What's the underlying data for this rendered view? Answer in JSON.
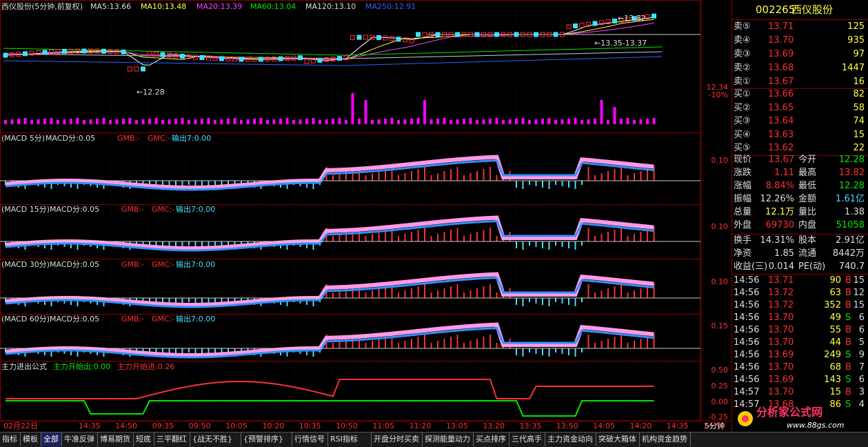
{
  "colors": {
    "red": "#ff3030",
    "cyan": "#40e0ff",
    "pink": "#ff99e6",
    "blue": "#3090ff",
    "magenta": "#ff00ff",
    "green": "#00e600",
    "yellow": "#ffff40",
    "grid": "#8b0000"
  },
  "main": {
    "title": "西仪股份(5分钟,前复权)",
    "ma5": "MA5:13.66",
    "ma10": "MA10:13.48",
    "ma20": "MA20:13.39",
    "ma60": "MA60:13.04",
    "ma120": "MA120:13.10",
    "ma250": "MA250:12.91",
    "low_annot": "←12.28",
    "high_annot": "←13.82",
    "range_annot": "←13.35-13.37",
    "scale_price": "12.34",
    "scale_pct": "-10%"
  },
  "panels": [
    {
      "name": "MACD 5分",
      "label": "(MACD 5分)",
      "param": "MACD分:0.05",
      "scale": "0.10"
    },
    {
      "name": "MACD 15分",
      "label": "(MACD 15分)",
      "param": "MACD分:0.05",
      "scale": "0.10"
    },
    {
      "name": "MACD 30分",
      "label": "(MACD 30分)",
      "param": "MACD分:0.05",
      "scale": "0.10"
    },
    {
      "name": "MACD 60分",
      "label": "(MACD 60分)",
      "param": "MACD分:0.05",
      "scale": "0.15"
    }
  ],
  "panel_tail": {
    "gmb": "GMB:-",
    "gmc": "GMC:-",
    "out": "输出7:0.00"
  },
  "zhuli": {
    "title": "主力进出公式",
    "start_out": "主力开始出:0.00",
    "start_in": "主力开始进:0.26",
    "scale": [
      "0.50",
      "0.25",
      "0.00",
      "-0.25"
    ]
  },
  "time_axis": {
    "date": "02月22日",
    "ticks": [
      "14:35",
      "14:50",
      "09:35",
      "09:50",
      "10:05",
      "10:20",
      "10:35",
      "10:50",
      "11:05",
      "11:20",
      "13:05",
      "13:20",
      "13:35",
      "13:50",
      "14:05",
      "14:20",
      "14:35",
      "14:50"
    ],
    "period": "5分钟"
  },
  "quote": {
    "code": "002265",
    "name": "西仪股份",
    "sells": [
      {
        "label": "卖⑤",
        "price": "13.71",
        "vol": "125"
      },
      {
        "label": "卖④",
        "price": "13.70",
        "vol": "935"
      },
      {
        "label": "卖③",
        "price": "13.69",
        "vol": "97"
      },
      {
        "label": "卖②",
        "price": "13.68",
        "vol": "1447"
      },
      {
        "label": "卖①",
        "price": "13.67",
        "vol": "16"
      }
    ],
    "buys": [
      {
        "label": "买①",
        "price": "13.66",
        "vol": "82"
      },
      {
        "label": "买②",
        "price": "13.65",
        "vol": "58"
      },
      {
        "label": "买③",
        "price": "13.64",
        "vol": "74"
      },
      {
        "label": "买④",
        "price": "13.63",
        "vol": "15"
      },
      {
        "label": "买⑤",
        "price": "13.62",
        "vol": "22"
      }
    ],
    "stats": [
      {
        "l1": "现价",
        "v1": "13.67",
        "l2": "今开",
        "v2": "12.28",
        "c1": "red",
        "c2": "green"
      },
      {
        "l1": "涨跌",
        "v1": "1.11",
        "l2": "最高",
        "v2": "13.82",
        "c1": "red",
        "c2": "red"
      },
      {
        "l1": "涨幅",
        "v1": "8.84%",
        "l2": "最低",
        "v2": "12.28",
        "c1": "red",
        "c2": "green"
      },
      {
        "l1": "振幅",
        "v1": "12.26%",
        "l2": "金额",
        "v2": "1.61亿",
        "c1": "white",
        "c2": "cyan"
      },
      {
        "l1": "总量",
        "v1": "12.1万",
        "l2": "量比",
        "v2": "1.38",
        "c1": "yellow",
        "c2": "white"
      },
      {
        "l1": "外盘",
        "v1": "69730",
        "l2": "内盘",
        "v2": "51058",
        "c1": "red",
        "c2": "green"
      }
    ],
    "stats2": [
      {
        "l1": "换手",
        "v1": "14.31%",
        "l2": "股本",
        "v2": "2.91亿"
      },
      {
        "l1": "净资",
        "v1": "1.85",
        "l2": "流通",
        "v2": "8442万"
      },
      {
        "l1": "收益(三)",
        "v1": "0.014",
        "l2": "PE(动)",
        "v2": "740.7"
      }
    ],
    "ticks": [
      {
        "t": "14:56",
        "p": "13.71",
        "v": "90",
        "s": "B",
        "n": "15"
      },
      {
        "t": "14:56",
        "p": "13.72",
        "v": "63",
        "s": "B",
        "n": "12"
      },
      {
        "t": "14:56",
        "p": "13.72",
        "v": "352",
        "s": "B",
        "n": "15"
      },
      {
        "t": "14:56",
        "p": "13.70",
        "v": "49",
        "s": "S",
        "n": "6"
      },
      {
        "t": "14:56",
        "p": "13.70",
        "v": "55",
        "s": "B",
        "n": "6"
      },
      {
        "t": "14:56",
        "p": "13.70",
        "v": "44",
        "s": "B",
        "n": "5"
      },
      {
        "t": "14:56",
        "p": "13.69",
        "v": "249",
        "s": "S",
        "n": "9"
      },
      {
        "t": "14:56",
        "p": "13.70",
        "v": "68",
        "s": "B",
        "n": "7"
      },
      {
        "t": "14:56",
        "p": "13.69",
        "v": "143",
        "s": "S",
        "n": "6"
      },
      {
        "t": "14:57",
        "p": "13.70",
        "v": "15",
        "s": "B",
        "n": "3"
      },
      {
        "t": "14:57",
        "p": "13.68",
        "v": "86",
        "s": "S",
        "n": "4"
      }
    ]
  },
  "watermark": {
    "text": "分析家公式网",
    "url": "www.88gs.com"
  },
  "toolbar": [
    "指标",
    "模板",
    "全部",
    "牛准反弹",
    "博易期货",
    "短底",
    "三平翻红",
    "{战无不胜}",
    "{预警排序}",
    "行情信号",
    "RSI指标",
    "开盘分时买卖",
    "探测能量动力",
    "买点排序",
    "三代高手",
    "主力资金动向",
    "突破大箱体",
    "机构资金趋势"
  ],
  "toolbar_active": "全部"
}
